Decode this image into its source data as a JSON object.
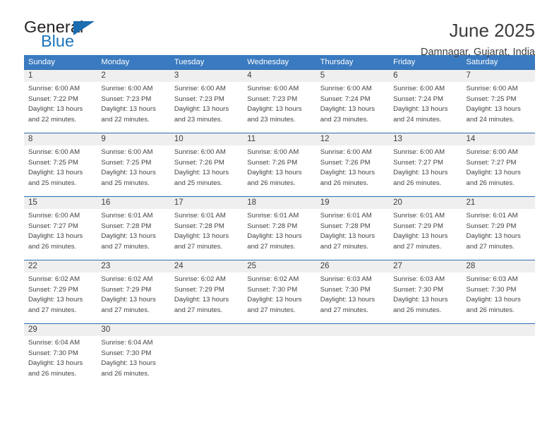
{
  "logo": {
    "word_top": "General",
    "word_bottom": "Blue",
    "triangle_color": "#1b6cb0",
    "text_color": "#231f20",
    "blue_color": "#1c75bc"
  },
  "header": {
    "title": "June 2025",
    "subtitle": "Damnagar, Gujarat, India"
  },
  "theme": {
    "header_blue": "#3a7ac0",
    "rule_blue": "#2f6cae",
    "daynum_band": "#efeff0",
    "text": "#444444"
  },
  "calendar": {
    "weekday_headers": [
      "Sunday",
      "Monday",
      "Tuesday",
      "Wednesday",
      "Thursday",
      "Friday",
      "Saturday"
    ],
    "weeks": [
      {
        "days": [
          {
            "num": "1",
            "sunrise": "Sunrise: 6:00 AM",
            "sunset": "Sunset: 7:22 PM",
            "daylight_1": "Daylight: 13 hours",
            "daylight_2": "and 22 minutes."
          },
          {
            "num": "2",
            "sunrise": "Sunrise: 6:00 AM",
            "sunset": "Sunset: 7:23 PM",
            "daylight_1": "Daylight: 13 hours",
            "daylight_2": "and 22 minutes."
          },
          {
            "num": "3",
            "sunrise": "Sunrise: 6:00 AM",
            "sunset": "Sunset: 7:23 PM",
            "daylight_1": "Daylight: 13 hours",
            "daylight_2": "and 23 minutes."
          },
          {
            "num": "4",
            "sunrise": "Sunrise: 6:00 AM",
            "sunset": "Sunset: 7:23 PM",
            "daylight_1": "Daylight: 13 hours",
            "daylight_2": "and 23 minutes."
          },
          {
            "num": "5",
            "sunrise": "Sunrise: 6:00 AM",
            "sunset": "Sunset: 7:24 PM",
            "daylight_1": "Daylight: 13 hours",
            "daylight_2": "and 23 minutes."
          },
          {
            "num": "6",
            "sunrise": "Sunrise: 6:00 AM",
            "sunset": "Sunset: 7:24 PM",
            "daylight_1": "Daylight: 13 hours",
            "daylight_2": "and 24 minutes."
          },
          {
            "num": "7",
            "sunrise": "Sunrise: 6:00 AM",
            "sunset": "Sunset: 7:25 PM",
            "daylight_1": "Daylight: 13 hours",
            "daylight_2": "and 24 minutes."
          }
        ]
      },
      {
        "days": [
          {
            "num": "8",
            "sunrise": "Sunrise: 6:00 AM",
            "sunset": "Sunset: 7:25 PM",
            "daylight_1": "Daylight: 13 hours",
            "daylight_2": "and 25 minutes."
          },
          {
            "num": "9",
            "sunrise": "Sunrise: 6:00 AM",
            "sunset": "Sunset: 7:25 PM",
            "daylight_1": "Daylight: 13 hours",
            "daylight_2": "and 25 minutes."
          },
          {
            "num": "10",
            "sunrise": "Sunrise: 6:00 AM",
            "sunset": "Sunset: 7:26 PM",
            "daylight_1": "Daylight: 13 hours",
            "daylight_2": "and 25 minutes."
          },
          {
            "num": "11",
            "sunrise": "Sunrise: 6:00 AM",
            "sunset": "Sunset: 7:26 PM",
            "daylight_1": "Daylight: 13 hours",
            "daylight_2": "and 26 minutes."
          },
          {
            "num": "12",
            "sunrise": "Sunrise: 6:00 AM",
            "sunset": "Sunset: 7:26 PM",
            "daylight_1": "Daylight: 13 hours",
            "daylight_2": "and 26 minutes."
          },
          {
            "num": "13",
            "sunrise": "Sunrise: 6:00 AM",
            "sunset": "Sunset: 7:27 PM",
            "daylight_1": "Daylight: 13 hours",
            "daylight_2": "and 26 minutes."
          },
          {
            "num": "14",
            "sunrise": "Sunrise: 6:00 AM",
            "sunset": "Sunset: 7:27 PM",
            "daylight_1": "Daylight: 13 hours",
            "daylight_2": "and 26 minutes."
          }
        ]
      },
      {
        "days": [
          {
            "num": "15",
            "sunrise": "Sunrise: 6:00 AM",
            "sunset": "Sunset: 7:27 PM",
            "daylight_1": "Daylight: 13 hours",
            "daylight_2": "and 26 minutes."
          },
          {
            "num": "16",
            "sunrise": "Sunrise: 6:01 AM",
            "sunset": "Sunset: 7:28 PM",
            "daylight_1": "Daylight: 13 hours",
            "daylight_2": "and 27 minutes."
          },
          {
            "num": "17",
            "sunrise": "Sunrise: 6:01 AM",
            "sunset": "Sunset: 7:28 PM",
            "daylight_1": "Daylight: 13 hours",
            "daylight_2": "and 27 minutes."
          },
          {
            "num": "18",
            "sunrise": "Sunrise: 6:01 AM",
            "sunset": "Sunset: 7:28 PM",
            "daylight_1": "Daylight: 13 hours",
            "daylight_2": "and 27 minutes."
          },
          {
            "num": "19",
            "sunrise": "Sunrise: 6:01 AM",
            "sunset": "Sunset: 7:28 PM",
            "daylight_1": "Daylight: 13 hours",
            "daylight_2": "and 27 minutes."
          },
          {
            "num": "20",
            "sunrise": "Sunrise: 6:01 AM",
            "sunset": "Sunset: 7:29 PM",
            "daylight_1": "Daylight: 13 hours",
            "daylight_2": "and 27 minutes."
          },
          {
            "num": "21",
            "sunrise": "Sunrise: 6:01 AM",
            "sunset": "Sunset: 7:29 PM",
            "daylight_1": "Daylight: 13 hours",
            "daylight_2": "and 27 minutes."
          }
        ]
      },
      {
        "days": [
          {
            "num": "22",
            "sunrise": "Sunrise: 6:02 AM",
            "sunset": "Sunset: 7:29 PM",
            "daylight_1": "Daylight: 13 hours",
            "daylight_2": "and 27 minutes."
          },
          {
            "num": "23",
            "sunrise": "Sunrise: 6:02 AM",
            "sunset": "Sunset: 7:29 PM",
            "daylight_1": "Daylight: 13 hours",
            "daylight_2": "and 27 minutes."
          },
          {
            "num": "24",
            "sunrise": "Sunrise: 6:02 AM",
            "sunset": "Sunset: 7:29 PM",
            "daylight_1": "Daylight: 13 hours",
            "daylight_2": "and 27 minutes."
          },
          {
            "num": "25",
            "sunrise": "Sunrise: 6:02 AM",
            "sunset": "Sunset: 7:30 PM",
            "daylight_1": "Daylight: 13 hours",
            "daylight_2": "and 27 minutes."
          },
          {
            "num": "26",
            "sunrise": "Sunrise: 6:03 AM",
            "sunset": "Sunset: 7:30 PM",
            "daylight_1": "Daylight: 13 hours",
            "daylight_2": "and 27 minutes."
          },
          {
            "num": "27",
            "sunrise": "Sunrise: 6:03 AM",
            "sunset": "Sunset: 7:30 PM",
            "daylight_1": "Daylight: 13 hours",
            "daylight_2": "and 26 minutes."
          },
          {
            "num": "28",
            "sunrise": "Sunrise: 6:03 AM",
            "sunset": "Sunset: 7:30 PM",
            "daylight_1": "Daylight: 13 hours",
            "daylight_2": "and 26 minutes."
          }
        ]
      },
      {
        "days": [
          {
            "num": "29",
            "sunrise": "Sunrise: 6:04 AM",
            "sunset": "Sunset: 7:30 PM",
            "daylight_1": "Daylight: 13 hours",
            "daylight_2": "and 26 minutes."
          },
          {
            "num": "30",
            "sunrise": "Sunrise: 6:04 AM",
            "sunset": "Sunset: 7:30 PM",
            "daylight_1": "Daylight: 13 hours",
            "daylight_2": "and 26 minutes."
          },
          {
            "num": "",
            "sunrise": "",
            "sunset": "",
            "daylight_1": "",
            "daylight_2": ""
          },
          {
            "num": "",
            "sunrise": "",
            "sunset": "",
            "daylight_1": "",
            "daylight_2": ""
          },
          {
            "num": "",
            "sunrise": "",
            "sunset": "",
            "daylight_1": "",
            "daylight_2": ""
          },
          {
            "num": "",
            "sunrise": "",
            "sunset": "",
            "daylight_1": "",
            "daylight_2": ""
          },
          {
            "num": "",
            "sunrise": "",
            "sunset": "",
            "daylight_1": "",
            "daylight_2": ""
          }
        ]
      }
    ]
  }
}
